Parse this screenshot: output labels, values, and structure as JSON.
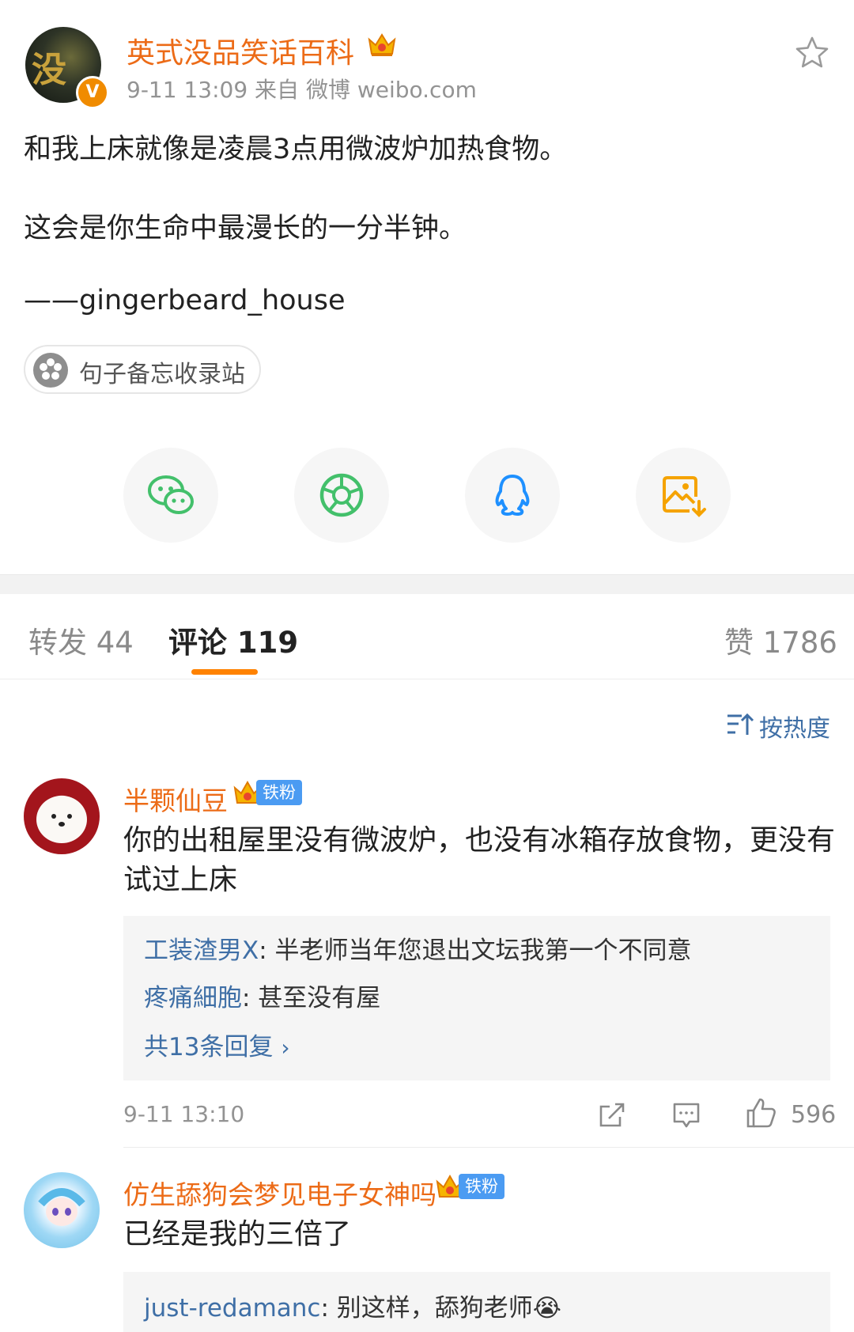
{
  "post": {
    "author": "英式没品笑话百科",
    "meta": "9-11 13:09   来自 微博 weibo.com",
    "avatar_glyph": "没",
    "verified_mark": "V",
    "lines": [
      "和我上床就像是凌晨3点用微波炉加热食物。",
      "这会是你生命中最漫长的一分半钟。",
      "——gingerbeard_house"
    ],
    "topic": "句子备忘收录站"
  },
  "share": {
    "items": [
      "wechat-icon",
      "moments-icon",
      "qq-icon",
      "save-image-icon"
    ],
    "colors": {
      "wechat": "#43c06b",
      "moments": "#43c06b",
      "qq": "#1e90ff",
      "save": "#f5a300"
    }
  },
  "tabs": {
    "repost": "转发 44",
    "comments": "评论 119",
    "likes": "赞 1786"
  },
  "sort_label": "按热度",
  "comments": [
    {
      "name": "半颗仙豆",
      "badge": "铁粉",
      "text": "你的出租屋里没有微波炉，也没有冰箱存放食物，更没有试过上床",
      "replies": [
        {
          "user": "工装渣男X",
          "text": ": 半老师当年您退出文坛我第一个不同意"
        },
        {
          "user": "疼痛細胞",
          "text": ": 甚至没有屋"
        }
      ],
      "more": "共13条回复",
      "date": "9-11 13:10",
      "likes": "596"
    },
    {
      "name": "仿生舔狗会梦见电子女神吗",
      "badge": "铁粉",
      "text": "已经是我的三倍了",
      "replies": [
        {
          "user": "just-redamanc",
          "text": ": 别这样，舔狗老师😭"
        }
      ]
    }
  ],
  "colors": {
    "accent": "#ff8200",
    "name": "#ec6b17",
    "link": "#3f6fa6"
  }
}
